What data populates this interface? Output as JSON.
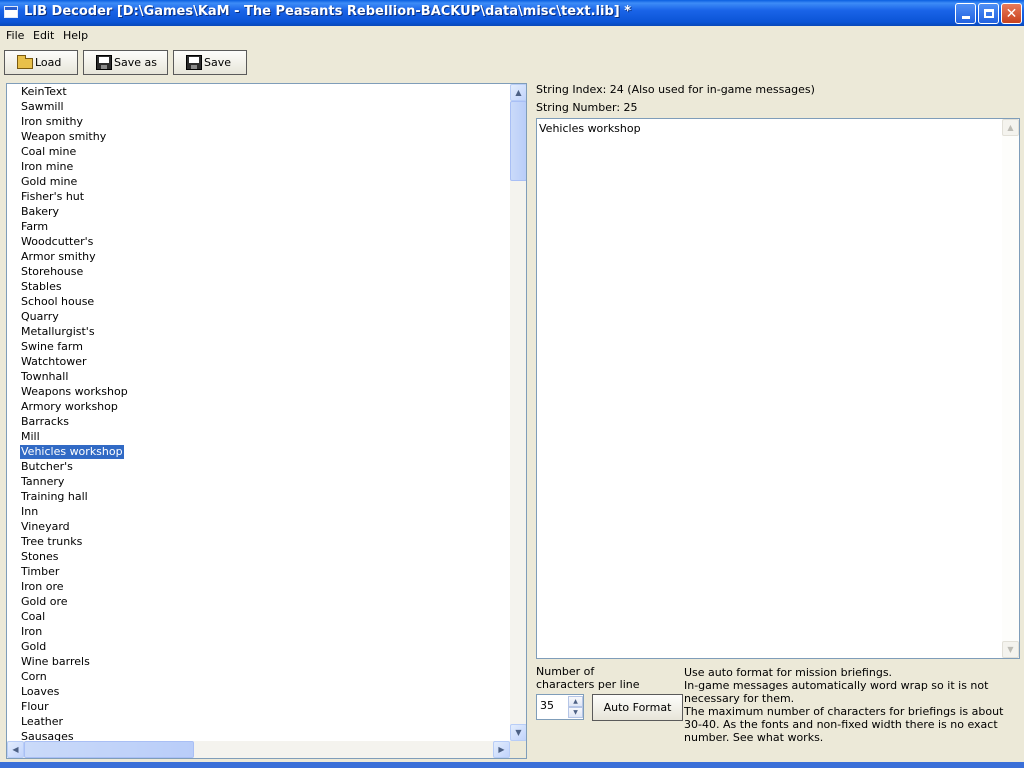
{
  "window": {
    "title": "LIB Decoder [D:\\Games\\KaM - The Peasants Rebellion-BACKUP\\data\\misc\\text.lib] *",
    "controls": {
      "minimize": "_",
      "maximize": "□",
      "close": "✕"
    }
  },
  "menu": {
    "file": "File",
    "edit": "Edit",
    "help": "Help"
  },
  "toolbar": {
    "load_label": "Load",
    "save_as_label": "Save as",
    "save_label": "Save",
    "load_icon": "open-folder-icon",
    "save_as_icon": "floppy-disk-icon",
    "save_icon": "floppy-disk-icon"
  },
  "string_list": {
    "items": [
      "KeinText",
      "Sawmill",
      "Iron smithy",
      "Weapon smithy",
      "Coal mine",
      "Iron mine",
      "Gold mine",
      "Fisher's hut",
      "Bakery",
      "Farm",
      "Woodcutter's",
      "Armor smithy",
      "Storehouse",
      "Stables",
      "School house",
      "Quarry",
      "Metallurgist's",
      "Swine farm",
      "Watchtower",
      "Townhall",
      "Weapons workshop",
      "Armory workshop",
      "Barracks",
      "Mill",
      "Vehicles workshop",
      "Butcher's",
      "Tannery",
      "Training hall",
      "Inn",
      "Vineyard",
      "Tree trunks",
      "Stones",
      "Timber",
      "Iron ore",
      "Gold ore",
      "Coal",
      "Iron",
      "Gold",
      "Wine barrels",
      "Corn",
      "Loaves",
      "Flour",
      "Leather",
      "Sausages"
    ],
    "selected_index": 24
  },
  "details": {
    "string_index_label": "String Index: 24 (Also used for in-game messages)",
    "string_number_label": "String Number: 25",
    "text_value": "Vehicles workshop"
  },
  "formatting": {
    "chars_label_line1": "Number of",
    "chars_label_line2": "characters per line",
    "chars_value": "35",
    "auto_format_label": "Auto Format",
    "help_line1": "Use auto format for mission briefings.",
    "help_line2": "In-game messages automatically word wrap so it is not necessary for them.",
    "help_line3": "The maximum number of characters for briefings is about 30-40. As the fonts and non-fixed width there is no exact number. See what works."
  },
  "colors": {
    "titlebar": "#0b54d6",
    "selection": "#316ac5",
    "window_bg": "#ece9d8"
  }
}
